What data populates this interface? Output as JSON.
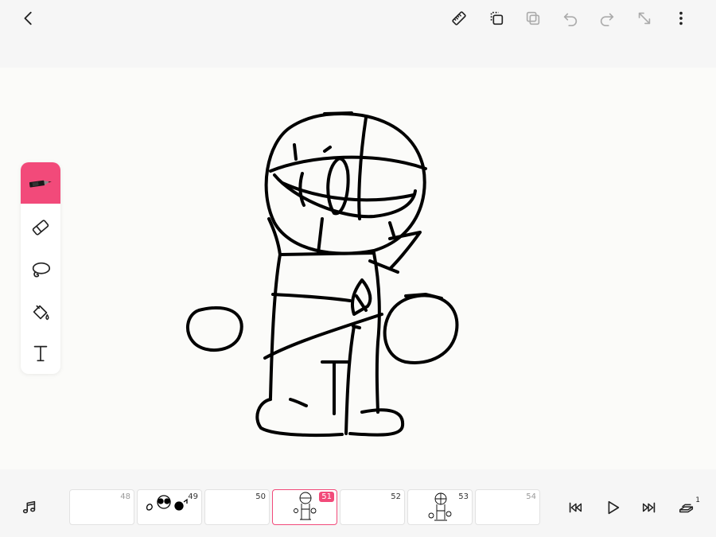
{
  "app": {
    "accent_color": "#f24a7a"
  },
  "header": {
    "icons": [
      "back-icon",
      "ruler-icon",
      "duplicate-icon",
      "copy-icon",
      "undo-icon",
      "redo-icon",
      "resize-icon",
      "more-icon"
    ]
  },
  "tools": [
    {
      "name": "pen",
      "icon": "pen-icon",
      "active": true
    },
    {
      "name": "eraser",
      "icon": "eraser-icon",
      "active": false
    },
    {
      "name": "lasso",
      "icon": "lasso-icon",
      "active": false
    },
    {
      "name": "fill",
      "icon": "paint-bucket-icon",
      "active": false
    },
    {
      "name": "text",
      "icon": "text-icon",
      "active": false
    }
  ],
  "timeline": {
    "current_frame": 51,
    "frames": [
      {
        "number": "48"
      },
      {
        "number": "49"
      },
      {
        "number": "50"
      },
      {
        "number": "51"
      },
      {
        "number": "52"
      },
      {
        "number": "53"
      },
      {
        "number": "54"
      }
    ]
  },
  "footer": {
    "icons": [
      "music-icon",
      "skip-start-icon",
      "play-icon",
      "skip-end-icon",
      "onion-skin-icon"
    ],
    "onion_skin_badge": "1"
  }
}
